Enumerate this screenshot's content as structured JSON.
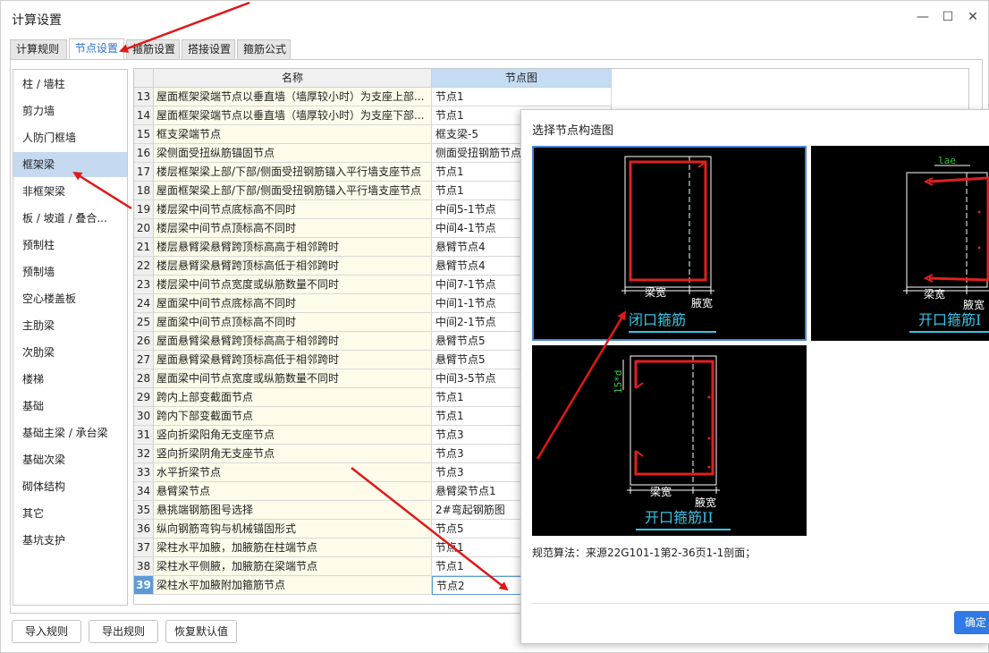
{
  "window": {
    "title": "计算设置",
    "minimize_glyph": "—",
    "maximize_glyph": "☐",
    "close_glyph": "✕"
  },
  "tabs": [
    {
      "label": "计算规则"
    },
    {
      "label": "节点设置"
    },
    {
      "label": "箍筋设置"
    },
    {
      "label": "搭接设置"
    },
    {
      "label": "箍筋公式"
    }
  ],
  "sidebar": {
    "items": [
      {
        "label": "柱 / 墙柱"
      },
      {
        "label": "剪力墙"
      },
      {
        "label": "人防门框墙"
      },
      {
        "label": "框架梁"
      },
      {
        "label": "非框架梁"
      },
      {
        "label": "板 / 坡道 / 叠合..."
      },
      {
        "label": "预制柱"
      },
      {
        "label": "预制墙"
      },
      {
        "label": "空心楼盖板"
      },
      {
        "label": "主肋梁"
      },
      {
        "label": "次肋梁"
      },
      {
        "label": "楼梯"
      },
      {
        "label": "基础"
      },
      {
        "label": "基础主梁 / 承台梁"
      },
      {
        "label": "基础次梁"
      },
      {
        "label": "砌体结构"
      },
      {
        "label": "其它"
      },
      {
        "label": "基坑支护"
      }
    ]
  },
  "grid": {
    "headers": {
      "name": "名称",
      "node": "节点图"
    },
    "rows": [
      {
        "num": "13",
        "name": "屋面框架梁端节点以垂直墙（墙厚较小时）为支座上部...",
        "node": "节点1"
      },
      {
        "num": "14",
        "name": "屋面框架梁端节点以垂直墙（墙厚较小时）为支座下部...",
        "node": "节点1"
      },
      {
        "num": "15",
        "name": "框支梁端节点",
        "node": "框支梁-5"
      },
      {
        "num": "16",
        "name": "梁侧面受扭纵筋锚固节点",
        "node": "侧面受扭钢筋节点"
      },
      {
        "num": "17",
        "name": "楼层框架梁上部/下部/侧面受扭钢筋锚入平行墙支座节点",
        "node": "节点1"
      },
      {
        "num": "18",
        "name": "屋面框架梁上部/下部/侧面受扭钢筋锚入平行墙支座节点",
        "node": "节点1"
      },
      {
        "num": "19",
        "name": "楼层梁中间节点底标高不同时",
        "node": "中间5-1节点"
      },
      {
        "num": "20",
        "name": "楼层梁中间节点顶标高不同时",
        "node": "中间4-1节点"
      },
      {
        "num": "21",
        "name": "楼层悬臂梁悬臂跨顶标高高于相邻跨时",
        "node": "悬臂节点4"
      },
      {
        "num": "22",
        "name": "楼层悬臂梁悬臂跨顶标高低于相邻跨时",
        "node": "悬臂节点4"
      },
      {
        "num": "23",
        "name": "楼层梁中间节点宽度或纵筋数量不同时",
        "node": "中间7-1节点"
      },
      {
        "num": "24",
        "name": "屋面梁中间节点底标高不同时",
        "node": "中间1-1节点"
      },
      {
        "num": "25",
        "name": "屋面梁中间节点顶标高不同时",
        "node": "中间2-1节点"
      },
      {
        "num": "26",
        "name": "屋面悬臂梁悬臂跨顶标高高于相邻跨时",
        "node": "悬臂节点5"
      },
      {
        "num": "27",
        "name": "屋面悬臂梁悬臂跨顶标高低于相邻跨时",
        "node": "悬臂节点5"
      },
      {
        "num": "28",
        "name": "屋面梁中间节点宽度或纵筋数量不同时",
        "node": "中间3-5节点"
      },
      {
        "num": "29",
        "name": "跨内上部变截面节点",
        "node": "节点1"
      },
      {
        "num": "30",
        "name": "跨内下部变截面节点",
        "node": "节点1"
      },
      {
        "num": "31",
        "name": "竖向折梁阳角无支座节点",
        "node": "节点3"
      },
      {
        "num": "32",
        "name": "竖向折梁阴角无支座节点",
        "node": "节点3"
      },
      {
        "num": "33",
        "name": "水平折梁节点",
        "node": "节点3"
      },
      {
        "num": "34",
        "name": "悬臂梁节点",
        "node": "悬臂梁节点1"
      },
      {
        "num": "35",
        "name": "悬挑端钢筋图号选择",
        "node": "2#弯起钢筋图"
      },
      {
        "num": "36",
        "name": "纵向钢筋弯钩与机械锚固形式",
        "node": "节点5"
      },
      {
        "num": "37",
        "name": "梁柱水平加腋，加腋筋在柱端节点",
        "node": "节点1"
      },
      {
        "num": "38",
        "name": "梁柱水平侧腋，加腋筋在梁端节点",
        "node": "节点1"
      },
      {
        "num": "39",
        "name": "梁柱水平加腋附加箍筋节点",
        "node": "节点2"
      }
    ]
  },
  "buttons": {
    "import": "导入规则",
    "export": "导出规则",
    "restore": "恢复默认值"
  },
  "popup": {
    "title": "选择节点构造图",
    "thumbs": [
      {
        "caption": "闭口箍筋",
        "beam_width": "梁宽",
        "haunch_width": "腋宽"
      },
      {
        "caption": "开口箍筋I",
        "beam_width": "梁宽",
        "haunch_width": "腋宽",
        "dim_label": "lae"
      },
      {
        "caption": "开口箍筋II",
        "beam_width": "梁宽",
        "haunch_width": "腋宽",
        "dim_label": "15*d"
      }
    ],
    "rule_text": "规范算法：来源22G101-1第2-36页1-1剖面；",
    "confirm_label": "确定"
  },
  "colors": {
    "accent": "#2f6fd0",
    "selection": "#c5d9f1",
    "header_highlight": "#c5dcf5",
    "name_cell_bg": "#fffbea",
    "rebar": "#e02020",
    "caption": "#33c6e8",
    "dim_green": "#2ecc40",
    "annotation_arrow": "#e01818",
    "confirm": "#2f7ae5"
  }
}
